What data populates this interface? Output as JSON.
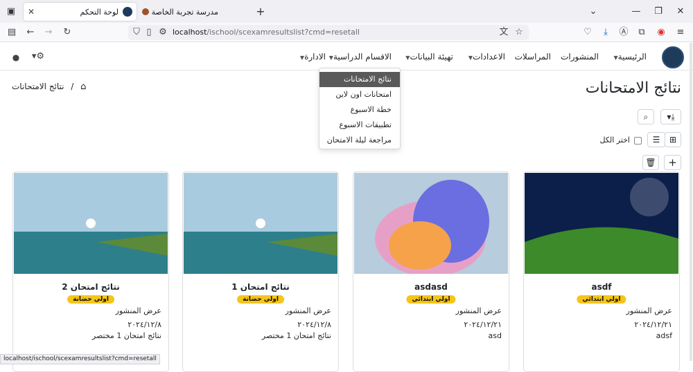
{
  "browser": {
    "tabs": [
      {
        "title": "لوحة التحكم",
        "active": true
      },
      {
        "title": "مدرسة تجربة الخاصة",
        "active": false
      }
    ],
    "new_tab": "+",
    "url_host": "localhost",
    "url_path": "/ischool/scexamresultslist?cmd=resetall"
  },
  "header": {
    "menu": [
      {
        "label": "الرئيسية",
        "caret": true
      },
      {
        "label": "المنشورات",
        "caret": false
      },
      {
        "label": "المراسلات",
        "caret": false
      },
      {
        "label": "الاعدادات",
        "caret": true
      },
      {
        "label": "تهيئة البيانات",
        "caret": true
      },
      {
        "label": "الاقسام الدراسية",
        "caret": true
      },
      {
        "label": "الادارة",
        "caret": true
      }
    ]
  },
  "dropdown": {
    "items": [
      "نتائج الامتحانات",
      "امتحانات اون لاين",
      "خطة الاسبوع",
      "تطبيقات الاسبوع",
      "مراجعة ليلة الامتحان"
    ],
    "selected": 0
  },
  "page": {
    "title": "نتائج الامتحانات",
    "breadcrumb": "نتائج الامتحانات",
    "select_all": "اختر الكل"
  },
  "cards": [
    {
      "title": "asdf",
      "badge": "اولي ابتدائي",
      "published": "عرض المنشور",
      "date": "٢٠٢٤/١٢/٢١",
      "desc": "adsf",
      "image": "landscape-icon"
    },
    {
      "title": "asdasd",
      "badge": "اولي ابتدائي",
      "published": "عرض المنشور",
      "date": "٢٠٢٤/١٢/٢١",
      "desc": "asd",
      "image": "abstract-icon"
    },
    {
      "title": "نتائج امتحان 1",
      "badge": "اولي حضانة",
      "published": "عرض المنشور",
      "date": "٢٠٢٤/١٢/٨",
      "desc": "نتائج امتحان 1 مختصر",
      "image": "lake-icon"
    },
    {
      "title": "نتائج امتحان 2",
      "badge": "اولي حضانة",
      "published": "عرض المنشور",
      "date": "٢٠٢٤/١٢/٨",
      "desc": "نتائج امتحان 1 مختصر",
      "image": "lake-icon"
    }
  ],
  "status_url": "localhost/ischool/scexamresultslist?cmd=resetall",
  "colors": {
    "badge": "#f5c518",
    "dropdown_selected": "#5a5a5a"
  }
}
